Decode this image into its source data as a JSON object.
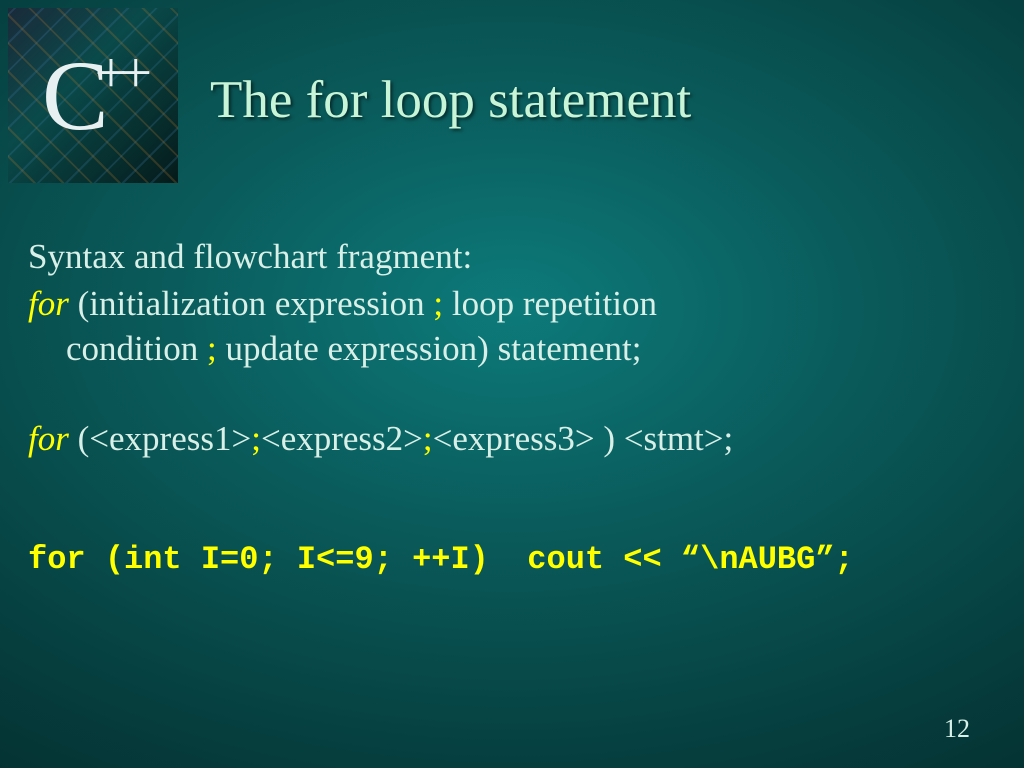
{
  "logo": {
    "text_c": "C",
    "text_plus": "++"
  },
  "title": "The for loop statement",
  "line1": "Syntax and flowchart fragment:",
  "for_kw": "for",
  "syntax1_a": " (initialization expression ",
  "semi": ";",
  "syntax1_b": " loop repetition",
  "syntax1_c": "condition ",
  "syntax1_d": " update expression) statement;",
  "syntax2_a": " (<express1>",
  "syntax2_b": "<express2>",
  "syntax2_c": "<express3> ) <stmt>;",
  "code": "for (int I=0; I<=9; ++I)  cout << “\\nAUBG”;",
  "page_number": "12"
}
